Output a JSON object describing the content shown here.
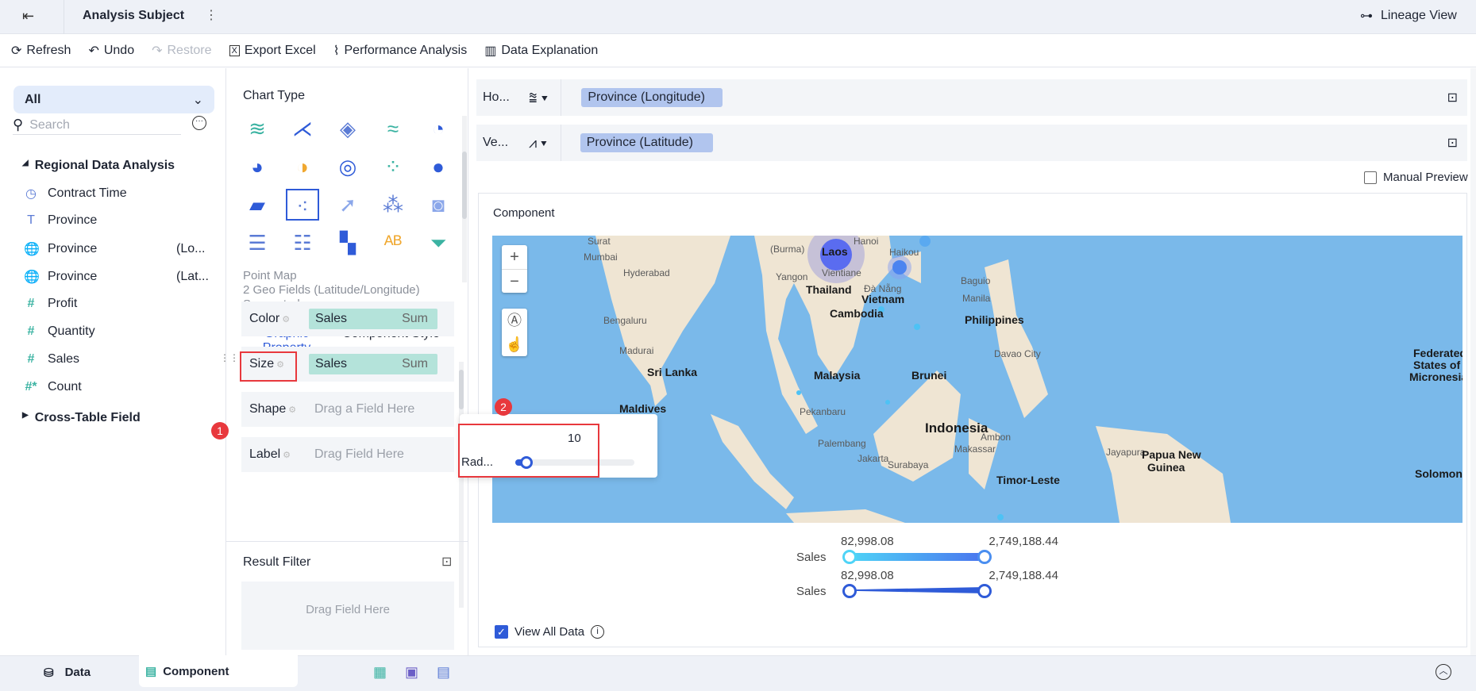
{
  "header": {
    "title": "Analysis Subject",
    "lineage": "Lineage View"
  },
  "toolbar": {
    "refresh": "Refresh",
    "undo": "Undo",
    "restore": "Restore",
    "export": "Export Excel",
    "performance": "Performance Analysis",
    "explanation": "Data Explanation"
  },
  "left": {
    "dropdown": "All",
    "search_placeholder": "Search",
    "group1": "Regional Data Analysis",
    "fields": [
      {
        "name": "Contract Time",
        "suffix": "",
        "icon": "clock-icon"
      },
      {
        "name": "Province",
        "suffix": "",
        "icon": "text-icon"
      },
      {
        "name": "Province",
        "suffix": "(Lo...",
        "icon": "globe-icon"
      },
      {
        "name": "Province",
        "suffix": "(Lat...",
        "icon": "globe-icon"
      },
      {
        "name": "Profit",
        "suffix": "",
        "icon": "hash-icon"
      },
      {
        "name": "Quantity",
        "suffix": "",
        "icon": "hash-icon"
      },
      {
        "name": "Sales",
        "suffix": "",
        "icon": "hash-icon"
      },
      {
        "name": "Count",
        "suffix": "",
        "icon": "hash-count-icon"
      }
    ],
    "group2": "Cross-Table Field"
  },
  "mid": {
    "chart_type": "Chart Type",
    "chart_name": "Point Map",
    "chart_req": "2 Geo Fields (Latitude/Longitude)",
    "chart_sugg": "Suggested",
    "tab1": "Graphic Property",
    "tab2": "Component Style",
    "props": [
      {
        "label": "Color",
        "field": "Sales",
        "agg": "Sum"
      },
      {
        "label": "Size",
        "field": "Sales",
        "agg": "Sum"
      },
      {
        "label": "Shape",
        "placeholder": "Drag a Field Here"
      },
      {
        "label": "Label",
        "placeholder": "Drag Field Here"
      }
    ],
    "result_filter": "Result Filter",
    "drag_here": "Drag Field Here"
  },
  "popup": {
    "value": "10",
    "label": "Rad...",
    "radius_fraction": 0.08,
    "badge1": "1",
    "badge2": "2"
  },
  "axes": {
    "h_label": "Ho...",
    "h_field": "Province (Longitude)",
    "v_label": "Ve...",
    "v_field": "Province (Latitude)",
    "manual_preview": "Manual Preview"
  },
  "component": {
    "title": "Component",
    "view_all": "View All Data"
  },
  "map": {
    "labels": [
      "Surat",
      "Mumbai",
      "Hyderabad",
      "Bengaluru",
      "Madurai",
      "Sri Lanka",
      "Maldives",
      "(Burma)",
      "Yangon",
      "Laos",
      "Vientiane",
      "Haikou",
      "Hanoi",
      "Đà Nẵng",
      "Thailand",
      "Vietnam",
      "Cambodia",
      "Baguio",
      "Manila",
      "Philippines",
      "Davao City",
      "Malaysia",
      "Brunei",
      "Pekanbaru",
      "Palembang",
      "Indonesia",
      "Jakarta",
      "Surabaya",
      "Makassar",
      "Ambon",
      "Jayapura",
      "Papua New",
      "Guinea",
      "Timor-Leste",
      "Federated",
      "States of",
      "Micronesia",
      "Solomon"
    ],
    "zoom_in": "+",
    "zoom_out": "−"
  },
  "legend": {
    "label1": "Sales",
    "min1": "82,998.08",
    "max1": "2,749,188.44",
    "label2": "Sales",
    "min2": "82,998.08",
    "max2": "2,749,188.44"
  },
  "bottom": {
    "data_tab": "Data",
    "component_tab": "Component"
  },
  "colors": {
    "accent": "#2f5bd8",
    "pill_green": "#b4e3da",
    "pill_blue": "#b1c5ee",
    "ocean": "#7ab9ea",
    "land": "#efe5d3"
  }
}
